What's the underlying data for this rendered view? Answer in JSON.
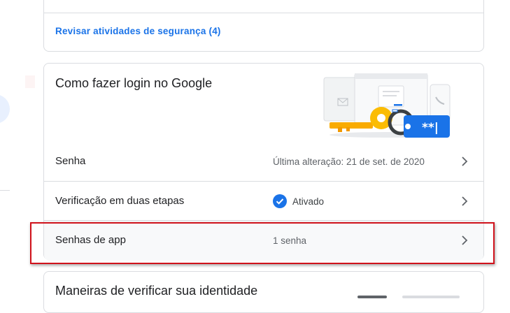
{
  "security_card": {
    "review_link": "Revisar atividades de segurança (4)"
  },
  "signin_card": {
    "title": "Como fazer login no Google",
    "illustration_password_mask": "**|",
    "rows": [
      {
        "label": "Senha",
        "value": "Última alteração: 21 de set. de 2020"
      },
      {
        "label": "Verificação em duas etapas",
        "value": "Ativado"
      },
      {
        "label": "Senhas de app",
        "value": "1 senha"
      }
    ]
  },
  "identity_card": {
    "title": "Maneiras de verificar sua identidade"
  },
  "colors": {
    "link_blue": "#1a73e8",
    "check_blue": "#1a73e8",
    "highlight_red": "#d0121b",
    "key_orange": "#f9ab00",
    "card_border": "#dadce0"
  },
  "icons": [
    "chevron-right-icon",
    "check-circle-icon",
    "key-illustration"
  ]
}
